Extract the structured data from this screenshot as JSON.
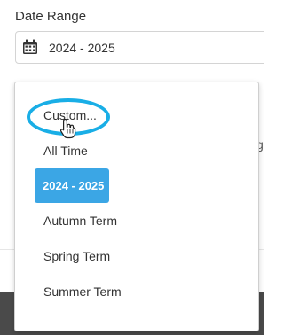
{
  "date_range": {
    "label": "Date Range",
    "value": "2024 - 2025",
    "icon": "calendar-icon"
  },
  "backdrop": {
    "partial_text": "ge"
  },
  "menu": {
    "items": [
      {
        "label": "Custom..."
      },
      {
        "label": "All Time"
      },
      {
        "label": "2024 - 2025",
        "selected": true
      },
      {
        "label": "Autumn Term"
      },
      {
        "label": "Spring Term"
      },
      {
        "label": "Summer Term"
      }
    ]
  },
  "colors": {
    "selected_bg": "#3ba6e5",
    "highlight_ring": "#19aee6"
  },
  "cursor": {
    "icon": "hand-pointer-icon"
  }
}
